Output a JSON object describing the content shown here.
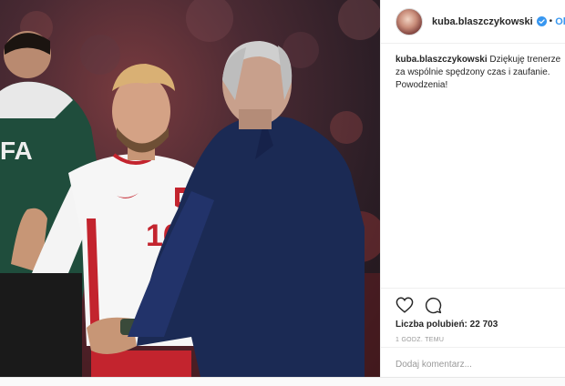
{
  "post": {
    "image_alt": "Photo of footballer in white jersey number 16 shaking hands with coach in navy suit",
    "jersey_number": "16",
    "bib_text": "FA"
  },
  "header": {
    "username": "kuba.blaszczykowski",
    "dot": "•",
    "follow_label": "Obserwuj"
  },
  "caption": {
    "username": "kuba.blaszczykowski",
    "text": " Dziękuję trenerze za wspólnie spędzony czas i zaufanie. Powodzenia!"
  },
  "actions": {
    "like_icon": "heart-icon",
    "comment_icon": "comment-icon"
  },
  "likes": {
    "text": "Liczba polubień: 22 703"
  },
  "time": {
    "text": "1 GODZ. TEMU"
  },
  "comment": {
    "placeholder": "Dodaj komentarz..."
  },
  "colors": {
    "link": "#3897f0",
    "text": "#262626",
    "muted": "#999999",
    "border": "#efefef"
  }
}
